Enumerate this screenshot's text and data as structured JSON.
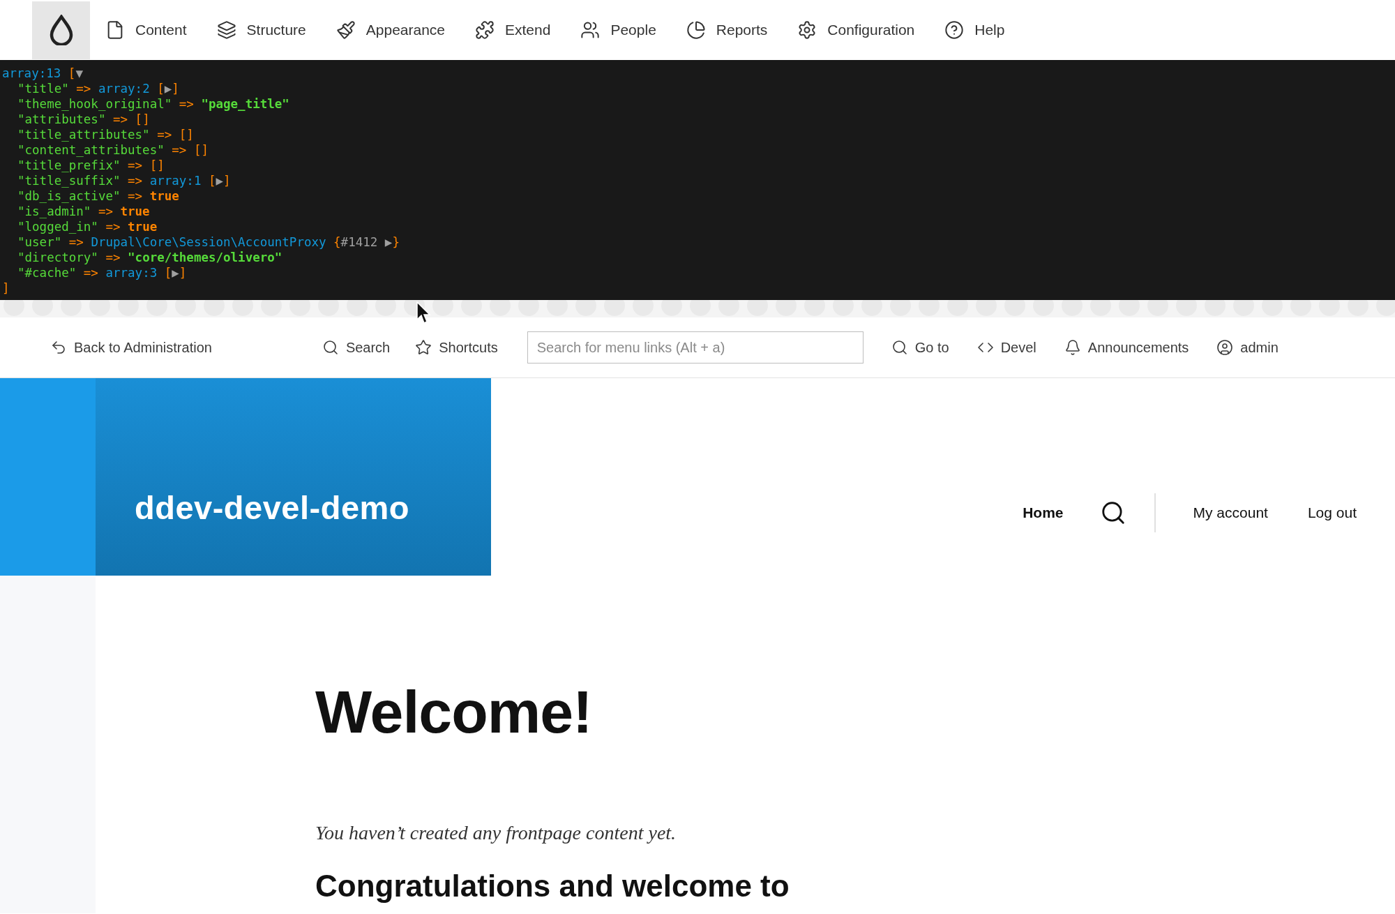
{
  "admin_menu": {
    "items": [
      {
        "label": "Content"
      },
      {
        "label": "Structure"
      },
      {
        "label": "Appearance"
      },
      {
        "label": "Extend"
      },
      {
        "label": "People"
      },
      {
        "label": "Reports"
      },
      {
        "label": "Configuration"
      },
      {
        "label": "Help"
      }
    ]
  },
  "dump": {
    "header": [
      {
        "text": "array:13",
        "kind": "type"
      },
      {
        "text": " [",
        "kind": "bracket"
      },
      {
        "text": "▼",
        "kind": "toggle"
      }
    ],
    "entries": [
      [
        {
          "text": "\"title\"",
          "kind": "key"
        },
        {
          "text": " => ",
          "kind": "op"
        },
        {
          "text": "array:2",
          "kind": "type"
        },
        {
          "text": " [",
          "kind": "bracket"
        },
        {
          "text": "▶",
          "kind": "toggle"
        },
        {
          "text": "]",
          "kind": "bracket"
        }
      ],
      [
        {
          "text": "\"theme_hook_original\"",
          "kind": "key"
        },
        {
          "text": " => ",
          "kind": "op"
        },
        {
          "text": "\"page_title\"",
          "kind": "string"
        }
      ],
      [
        {
          "text": "\"attributes\"",
          "kind": "key"
        },
        {
          "text": " => ",
          "kind": "op"
        },
        {
          "text": "[]",
          "kind": "bracket"
        }
      ],
      [
        {
          "text": "\"title_attributes\"",
          "kind": "key"
        },
        {
          "text": " => ",
          "kind": "op"
        },
        {
          "text": "[]",
          "kind": "bracket"
        }
      ],
      [
        {
          "text": "\"content_attributes\"",
          "kind": "key"
        },
        {
          "text": " => ",
          "kind": "op"
        },
        {
          "text": "[]",
          "kind": "bracket"
        }
      ],
      [
        {
          "text": "\"title_prefix\"",
          "kind": "key"
        },
        {
          "text": " => ",
          "kind": "op"
        },
        {
          "text": "[]",
          "kind": "bracket"
        }
      ],
      [
        {
          "text": "\"title_suffix\"",
          "kind": "key"
        },
        {
          "text": " => ",
          "kind": "op"
        },
        {
          "text": "array:1",
          "kind": "type"
        },
        {
          "text": " [",
          "kind": "bracket"
        },
        {
          "text": "▶",
          "kind": "toggle"
        },
        {
          "text": "]",
          "kind": "bracket"
        }
      ],
      [
        {
          "text": "\"db_is_active\"",
          "kind": "key"
        },
        {
          "text": " => ",
          "kind": "op"
        },
        {
          "text": "true",
          "kind": "bool"
        }
      ],
      [
        {
          "text": "\"is_admin\"",
          "kind": "key"
        },
        {
          "text": " => ",
          "kind": "op"
        },
        {
          "text": "true",
          "kind": "bool"
        }
      ],
      [
        {
          "text": "\"logged_in\"",
          "kind": "key"
        },
        {
          "text": " => ",
          "kind": "op"
        },
        {
          "text": "true",
          "kind": "bool"
        }
      ],
      [
        {
          "text": "\"user\"",
          "kind": "key"
        },
        {
          "text": " => ",
          "kind": "op"
        },
        {
          "text": "Drupal\\Core\\Session\\AccountProxy",
          "kind": "type"
        },
        {
          "text": " {",
          "kind": "bracket"
        },
        {
          "text": "#1412 ▶",
          "kind": "toggle"
        },
        {
          "text": "}",
          "kind": "bracket"
        }
      ],
      [
        {
          "text": "\"directory\"",
          "kind": "key"
        },
        {
          "text": " => ",
          "kind": "op"
        },
        {
          "text": "\"core/themes/olivero\"",
          "kind": "string"
        }
      ],
      [
        {
          "text": "\"#cache\"",
          "kind": "key"
        },
        {
          "text": " => ",
          "kind": "op"
        },
        {
          "text": "array:3",
          "kind": "type"
        },
        {
          "text": " [",
          "kind": "bracket"
        },
        {
          "text": "▶",
          "kind": "toggle"
        },
        {
          "text": "]",
          "kind": "bracket"
        }
      ]
    ],
    "footer": [
      {
        "text": "]",
        "kind": "bracket"
      }
    ]
  },
  "toolbar": {
    "back": "Back to Administration",
    "search": "Search",
    "shortcuts": "Shortcuts",
    "menu_search": {
      "placeholder": "Search for menu links (Alt + a)"
    },
    "goto": "Go to",
    "devel": "Devel",
    "announcements": "Announcements",
    "user": "admin"
  },
  "site": {
    "name": "ddev-devel-demo",
    "nav": [
      {
        "label": "Home",
        "selected": true
      },
      {
        "label": "My account",
        "selected": false
      },
      {
        "label": "Log out",
        "selected": false
      }
    ]
  },
  "content": {
    "title": "Welcome!",
    "message": "You haven’t created any frontpage content yet.",
    "heading": "Congratulations and welcome to"
  }
}
